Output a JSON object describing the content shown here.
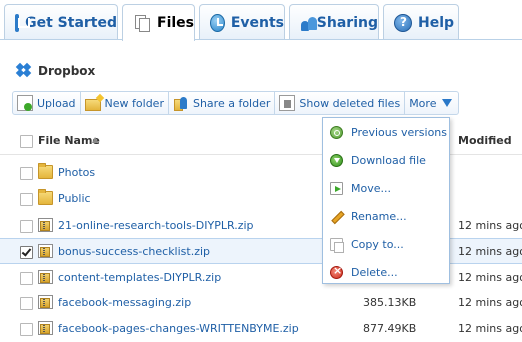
{
  "tabs": [
    {
      "label": "Get Started",
      "icon": "get-started-icon",
      "active": false
    },
    {
      "label": "Files",
      "icon": "files-icon",
      "active": true
    },
    {
      "label": "Events",
      "icon": "events-icon",
      "active": false
    },
    {
      "label": "Sharing",
      "icon": "sharing-icon",
      "active": false
    },
    {
      "label": "Help",
      "icon": "help-icon",
      "active": false
    }
  ],
  "breadcrumb": {
    "label": "Dropbox",
    "icon": "dropbox-icon"
  },
  "toolbar": {
    "upload": "Upload",
    "new_folder": "New folder",
    "share_folder": "Share a folder",
    "show_deleted": "Show deleted files",
    "more": "More"
  },
  "table": {
    "col_name": "File Name",
    "sort_indicator": "▲",
    "col_modified": "Modified",
    "rows": [
      {
        "name": "Photos",
        "type": "folder",
        "size": "",
        "modified": "",
        "checked": false
      },
      {
        "name": "Public",
        "type": "folder",
        "size": "",
        "modified": "",
        "checked": false
      },
      {
        "name": "21-online-research-tools-DIYPLR.zip",
        "type": "zip",
        "size": "",
        "modified": "12 mins ago",
        "checked": false
      },
      {
        "name": "bonus-success-checklist.zip",
        "type": "zip",
        "size": "",
        "modified": "12 mins ago",
        "checked": true
      },
      {
        "name": "content-templates-DIYPLR.zip",
        "type": "zip",
        "size": "",
        "modified": "12 mins ago",
        "checked": false
      },
      {
        "name": "facebook-messaging.zip",
        "type": "zip",
        "size": "385.13KB",
        "modified": "12 mins ago",
        "checked": false
      },
      {
        "name": "facebook-pages-changes-WRITTENBYME.zip",
        "type": "zip",
        "size": "877.49KB",
        "modified": "12 mins ago",
        "checked": false
      }
    ]
  },
  "more_menu": {
    "items": [
      {
        "label": "Previous versions",
        "icon": "previous-versions-icon"
      },
      {
        "label": "Download file",
        "icon": "download-icon"
      },
      {
        "label": "Move...",
        "icon": "move-icon"
      },
      {
        "label": "Rename...",
        "icon": "rename-icon"
      },
      {
        "label": "Copy to...",
        "icon": "copy-icon"
      },
      {
        "label": "Delete...",
        "icon": "delete-icon"
      }
    ]
  },
  "colors": {
    "link": "#1f5fa6",
    "selected_row": "#edf4fc",
    "accent": "#2a78c8"
  }
}
